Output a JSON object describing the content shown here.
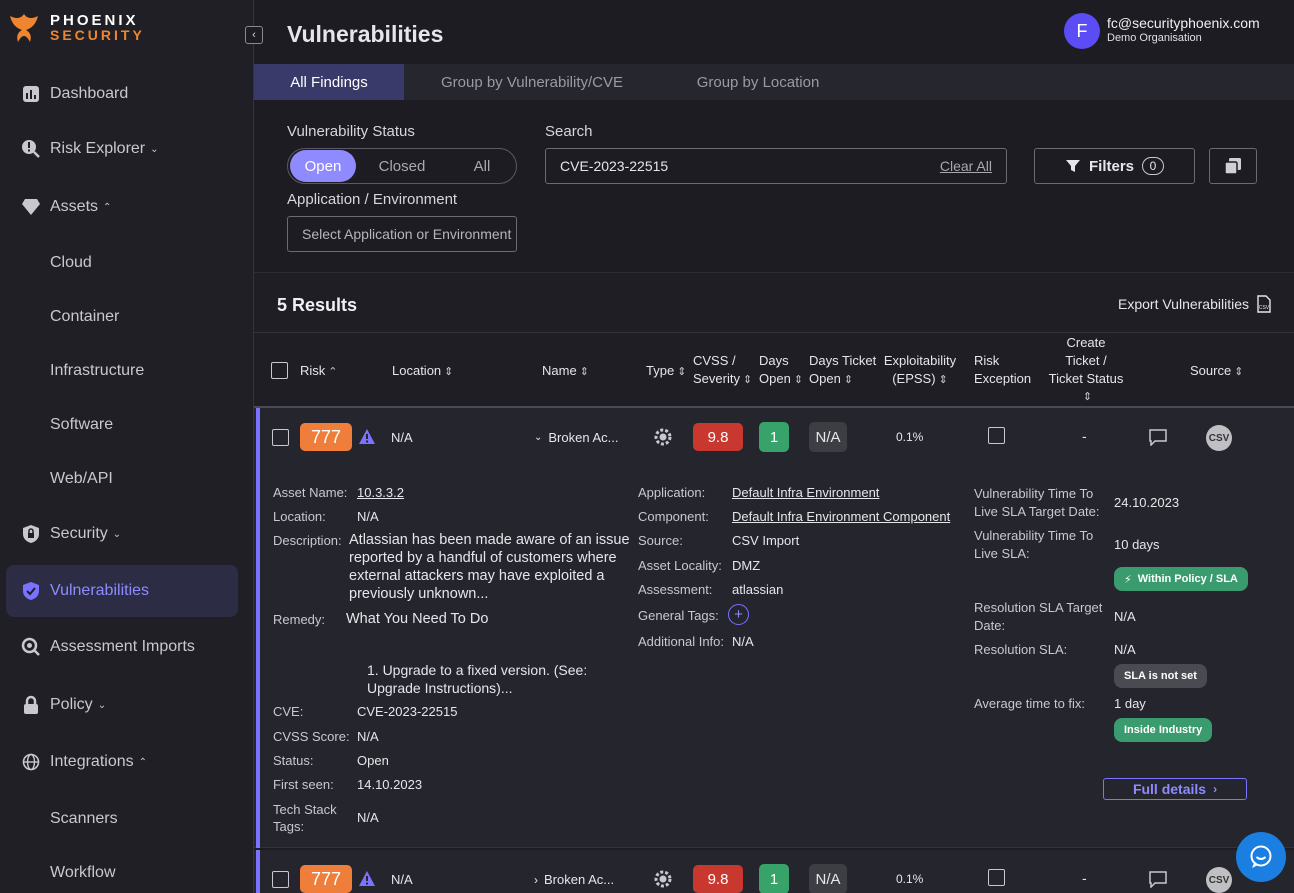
{
  "brand": {
    "line1": "PHOENIX",
    "line2": "SECURITY"
  },
  "sidebar": {
    "items": [
      {
        "label": "Dashboard",
        "icon": "bar-chart-icon"
      },
      {
        "label": "Risk Explorer",
        "icon": "risk-search-icon",
        "chevron": "⌄"
      },
      {
        "label": "Assets",
        "icon": "diamond-icon",
        "chevron": "⌃"
      },
      {
        "label": "Cloud"
      },
      {
        "label": "Container"
      },
      {
        "label": "Infrastructure"
      },
      {
        "label": "Software"
      },
      {
        "label": "Web/API"
      },
      {
        "label": "Security",
        "icon": "lock-shield-icon",
        "chevron": "⌄"
      },
      {
        "label": "Vulnerabilities",
        "icon": "shield-check-icon"
      },
      {
        "label": "Assessment Imports",
        "icon": "magnifier-icon"
      },
      {
        "label": "Policy",
        "icon": "padlock-icon",
        "chevron": "⌄"
      },
      {
        "label": "Integrations",
        "icon": "globe-icon",
        "chevron": "⌃"
      },
      {
        "label": "Scanners"
      },
      {
        "label": "Workflow"
      }
    ]
  },
  "header": {
    "title": "Vulnerabilities"
  },
  "user": {
    "initial": "F",
    "email": "fc@securityphoenix.com",
    "org": "Demo Organisation"
  },
  "tabs": [
    "All Findings",
    "Group by Vulnerability/CVE",
    "Group by Location"
  ],
  "filters": {
    "status_label": "Vulnerability Status",
    "status_options": [
      "Open",
      "Closed",
      "All"
    ],
    "search_label": "Search",
    "search_value": "CVE-2023-22515",
    "clear_all": "Clear All",
    "filters_label": "Filters",
    "filters_count": "0",
    "app_env_label": "Application / Environment",
    "app_env_placeholder": "Select Application or Environment"
  },
  "results": {
    "count_label": "5 Results",
    "export_label": "Export Vulnerabilities"
  },
  "table": {
    "headers": {
      "risk": "Risk",
      "location": "Location",
      "name": "Name",
      "type": "Type",
      "cvss": [
        "CVSS /",
        "Severity"
      ],
      "days_open": [
        "Days",
        "Open"
      ],
      "days_ticket_open": [
        "Days Ticket",
        "Open"
      ],
      "epss": [
        "Exploitability",
        "(EPSS)"
      ],
      "risk_exception": [
        "Risk",
        "Exception"
      ],
      "ticket": [
        "Create",
        "Ticket /",
        "Ticket Status"
      ],
      "source": "Source"
    },
    "rows": [
      {
        "risk": "777",
        "location": "N/A",
        "name": "Broken Ac...",
        "cvss": "9.8",
        "days_open": "1",
        "days_ticket": "N/A",
        "epss": "0.1%",
        "ticket": "-",
        "source": "CSV",
        "expanded": true
      },
      {
        "risk": "777",
        "location": "N/A",
        "name": "Broken Ac...",
        "cvss": "9.8",
        "days_open": "1",
        "days_ticket": "N/A",
        "epss": "0.1%",
        "ticket": "-",
        "source": "CSV",
        "expanded": false
      }
    ]
  },
  "detail": {
    "asset_name_label": "Asset Name:",
    "asset_name": "10.3.3.2",
    "location_label": "Location:",
    "location": "N/A",
    "description_label": "Description:",
    "description": "Atlassian has been made aware of an issue reported by a handful of customers where external attackers may have exploited a previously unknown...",
    "remedy_label": "Remedy:",
    "remedy_title": "What You Need To Do",
    "remedy_step": "1.  Upgrade to a fixed version. (See: Upgrade Instructions)...",
    "cve_label": "CVE:",
    "cve": "CVE-2023-22515",
    "cvss_score_label": "CVSS Score:",
    "cvss_score": "N/A",
    "status_label": "Status:",
    "status": "Open",
    "first_seen_label": "First seen:",
    "first_seen": "14.10.2023",
    "tech_stack_label": "Tech Stack Tags:",
    "tech_stack": "N/A",
    "application_label": "Application:",
    "application": "Default Infra Environment",
    "component_label": "Component:",
    "component": "Default Infra Environment Component",
    "source_label": "Source:",
    "source": "CSV Import",
    "locality_label": "Asset Locality:",
    "locality": "DMZ",
    "assessment_label": "Assessment:",
    "assessment": "atlassian",
    "general_tags_label": "General Tags:",
    "additional_info_label": "Additional Info:",
    "additional_info": "N/A",
    "vttl_target_label": "Vulnerability Time To Live SLA Target Date:",
    "vttl_target": "24.10.2023",
    "vttl_sla_label": "Vulnerability Time To Live SLA:",
    "vttl_sla": "10 days",
    "within_policy": "Within Policy / SLA",
    "res_target_label": "Resolution SLA Target Date:",
    "res_target": "N/A",
    "res_sla_label": "Resolution SLA:",
    "res_sla": "N/A",
    "sla_not_set": "SLA is not set",
    "avg_fix_label": "Average time to fix:",
    "avg_fix": "1 day",
    "inside_industry": "Inside Industry",
    "full_details": "Full details"
  },
  "colors": {
    "accent": "#8f8bff",
    "risk": "#ef7e3a",
    "cvss_critical": "#c8382e",
    "days_green": "#37a36b",
    "brand_orange": "#f0852f"
  }
}
